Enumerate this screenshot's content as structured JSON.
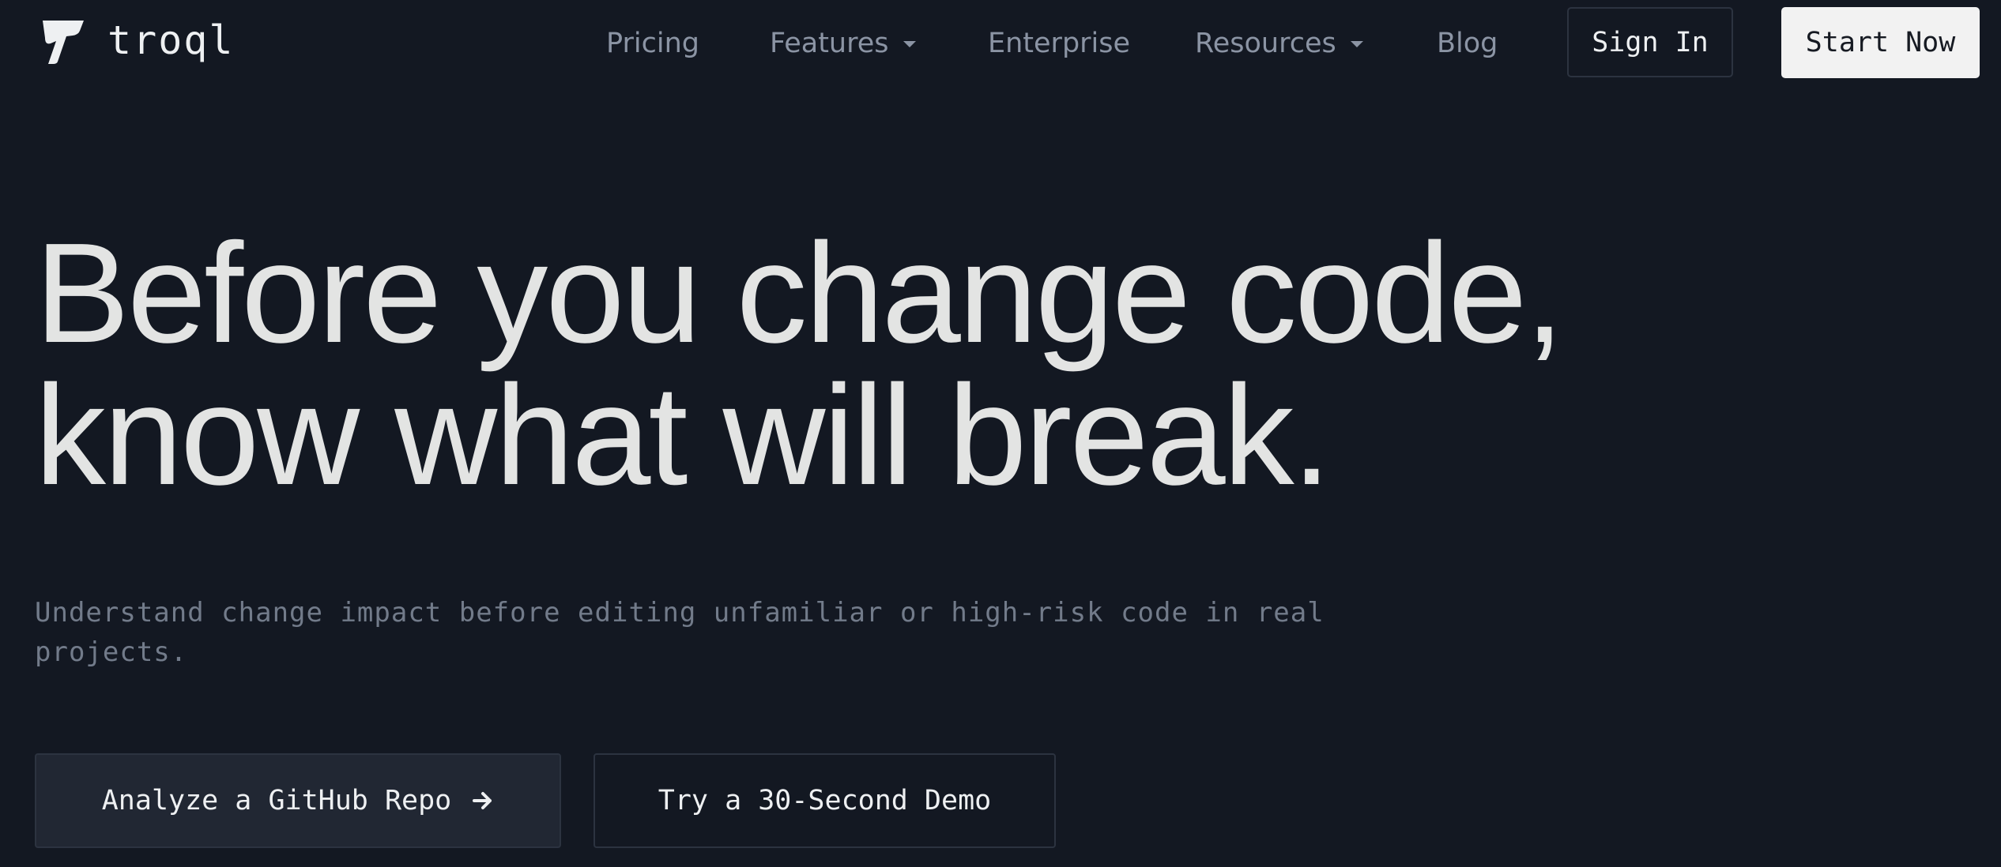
{
  "brand": {
    "name": "troql",
    "logo_icon": "troql-logo-mark"
  },
  "nav": {
    "items": [
      {
        "label": "Pricing",
        "has_dropdown": false
      },
      {
        "label": "Features",
        "has_dropdown": true
      },
      {
        "label": "Enterprise",
        "has_dropdown": false
      },
      {
        "label": "Resources",
        "has_dropdown": true
      },
      {
        "label": "Blog",
        "has_dropdown": false
      }
    ],
    "sign_in_label": "Sign In",
    "start_label": "Start Now"
  },
  "hero": {
    "title_line1": "Before you change code,",
    "title_line2": "know what will break.",
    "subtitle": "Understand change impact before editing unfamiliar or high-risk code in real projects."
  },
  "cta": {
    "analyze_label": "Analyze a GitHub Repo",
    "analyze_icon": "arrow-right-icon",
    "demo_label": "Try a 30-Second Demo"
  },
  "colors": {
    "background": "#131822",
    "headline": "#e3e4e3",
    "nav_text": "#8b94a4",
    "subtitle": "#727b8a",
    "primary_button_bg": "#f2f2f2",
    "secondary_button_bg": "#212733",
    "border": "#2c3340"
  }
}
